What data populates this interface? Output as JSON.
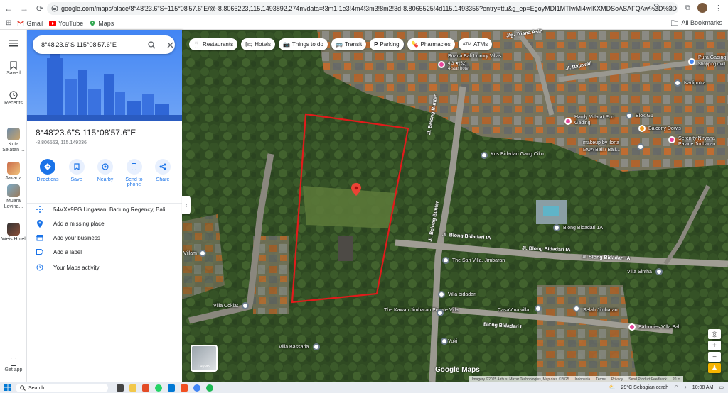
{
  "browser": {
    "url": "google.com/maps/place/8°48'23.6\"S+115°08'57.6\"E/@-8.8066223,115.1493892,274m/data=!3m1!1e3!4m4!3m3!8m2!3d-8.8065525!4d115.1493356?entry=ttu&g_ep=EgoyMDI1MTIwMi4wIKXMDSoASAFQAw%3D%3D",
    "bookmarks": [
      {
        "label": "Gmail"
      },
      {
        "label": "YouTube"
      },
      {
        "label": "Maps"
      }
    ],
    "all_bookmarks": "All Bookmarks"
  },
  "rail": {
    "saved": "Saved",
    "recents": "Recents",
    "recent_places": [
      "Kuta Selatan ...",
      "Jakarta",
      "Muara Lovina...",
      "Weis Hotel"
    ],
    "get_app": "Get app"
  },
  "panel": {
    "search_value": "8°48'23.6\"S 115°08'57.6\"E",
    "title": "8°48'23.6\"S 115°08'57.6\"E",
    "subtitle": "-8.806553, 115.149336",
    "actions": [
      "Directions",
      "Save",
      "Nearby",
      "Send to phone",
      "Share"
    ],
    "info": [
      "54VX+9PG Ungasan, Badung Regency, Bali",
      "Add a missing place",
      "Add your business",
      "Add a label",
      "Your Maps activity"
    ]
  },
  "map": {
    "chips": [
      "Restaurants",
      "Hotels",
      "Things to do",
      "Transit",
      "Parking",
      "Pharmacies",
      "ATMs"
    ],
    "places": [
      {
        "name": "Buana Bali Luxury Villas"
      },
      {
        "name": "4.3 ★(52)"
      },
      {
        "name": "4-star hotel"
      },
      {
        "name": "Jl. Rajawali"
      },
      {
        "name": "Jlg. Triana Asih"
      },
      {
        "name": "Pura Gading"
      },
      {
        "name": "Shopping mall"
      },
      {
        "name": "Nadiputra"
      },
      {
        "name": "Jl. Belong Bunter"
      },
      {
        "name": "Hardy Villa at Puri Gading"
      },
      {
        "name": "Blok G1"
      },
      {
        "name": "Balcony Dow's"
      },
      {
        "name": "makeup by ilona"
      },
      {
        "name": "MUA Bali / Bali..."
      },
      {
        "name": "Serenity Nirvana Palace Jimbaran"
      },
      {
        "name": "Kos Bidadari Gang Ciko"
      },
      {
        "name": "Blong Bidadari 1A"
      },
      {
        "name": "Jl. Blong Bidadari IA"
      },
      {
        "name": "Jl. Blong Bidadari IA"
      },
      {
        "name": "Jl. Blong Bidadari IA"
      },
      {
        "name": "The Sari Villa, Jimbaran"
      },
      {
        "name": "Villa Sintha"
      },
      {
        "name": "Villa bidadari"
      },
      {
        "name": "The Kawan Jimbaran Private Villa"
      },
      {
        "name": "CasaVina villa"
      },
      {
        "name": "Selah Jimbaran"
      },
      {
        "name": "Balconies Villa Bali"
      },
      {
        "name": "Blong Bidadari I"
      },
      {
        "name": "Villa Coklat"
      },
      {
        "name": "Villa Bassaria"
      },
      {
        "name": "Yuki"
      },
      {
        "name": "Villam"
      },
      {
        "name": "Jl. Belong Bunter"
      }
    ],
    "layers_label": "Layers",
    "logo": "Google Maps",
    "attribution": [
      "Imagery ©2025 Airbus, Maxar Technologies, Map data ©2025",
      "Indonesia",
      "Terms",
      "Privacy",
      "Send Product Feedback",
      "20 m"
    ]
  },
  "taskbar": {
    "search": "Search",
    "weather": "29°C  Sebagian cerah",
    "time": "10:08 AM"
  },
  "colors": {
    "accent": "#1a73e8",
    "pin": "#ea4335",
    "boundary": "#e11b1b"
  }
}
